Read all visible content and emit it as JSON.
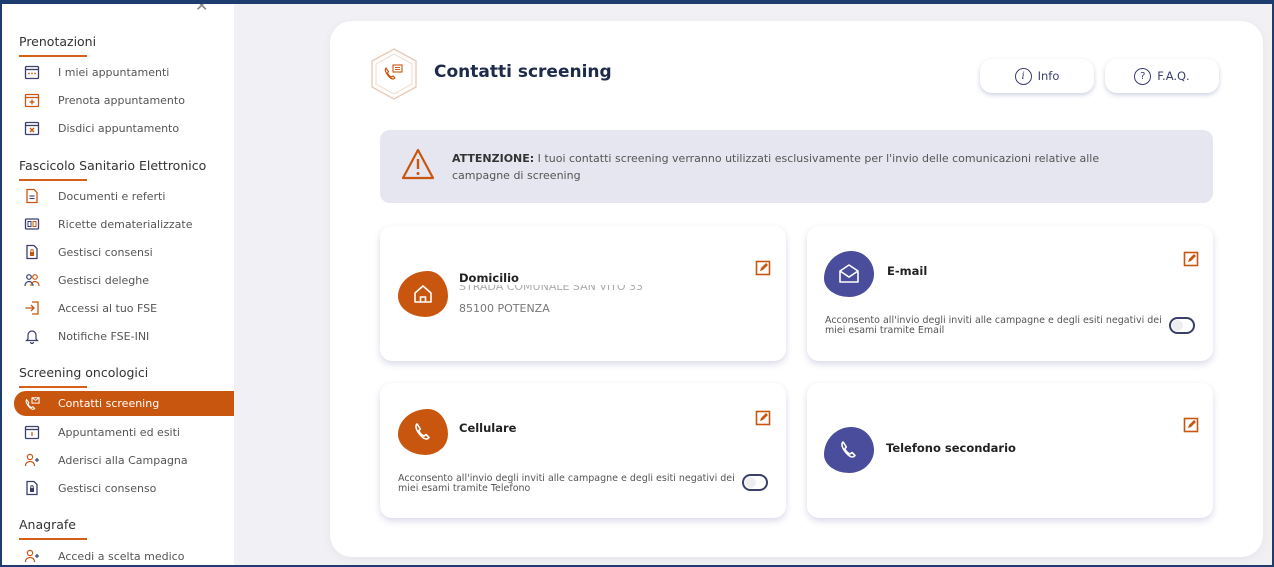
{
  "sidebar": {
    "sections": [
      {
        "title": "Prenotazioni"
      },
      {
        "title": "Fascicolo Sanitario Elettronico"
      },
      {
        "title": "Screening oncologici"
      },
      {
        "title": "Anagrafe"
      }
    ],
    "items": [
      {
        "label": "I miei appuntamenti",
        "icon": "calendar-icon"
      },
      {
        "label": "Prenota appuntamento",
        "icon": "calendar-plus-icon"
      },
      {
        "label": "Disdici appuntamento",
        "icon": "calendar-cancel-icon"
      },
      {
        "label": "Documenti e referti",
        "icon": "document-icon"
      },
      {
        "label": "Ricette dematerializzate",
        "icon": "prescription-icon"
      },
      {
        "label": "Gestisci consensi",
        "icon": "lock-document-icon"
      },
      {
        "label": "Gestisci deleghe",
        "icon": "users-icon"
      },
      {
        "label": "Accessi al tuo FSE",
        "icon": "login-icon"
      },
      {
        "label": "Notifiche FSE-INI",
        "icon": "bell-icon"
      },
      {
        "label": "Contatti screening",
        "icon": "phone-mail-icon",
        "active": true
      },
      {
        "label": "Appuntamenti ed esiti",
        "icon": "calendar-icon"
      },
      {
        "label": "Aderisci alla Campagna",
        "icon": "user-plus-icon"
      },
      {
        "label": "Gestisci consenso",
        "icon": "lock-document-icon"
      },
      {
        "label": "Accedi a scelta medico",
        "icon": "user-plus-icon"
      }
    ]
  },
  "main": {
    "title": "Contatti screening",
    "info_label": "Info",
    "faq_label": "F.A.Q.",
    "alert": {
      "bold": "ATTENZIONE:",
      "text": " I tuoi contatti screening verranno utilizzati esclusivamente per l'invio delle comunicazioni relative alle campagne di screening"
    },
    "cards": {
      "domicilio": {
        "title": "Domicilio",
        "address": "STRADA COMUNALE SAN VITO 33",
        "city": "85100 POTENZA"
      },
      "email": {
        "title": "E-mail",
        "consent": "Acconsento all'invio degli inviti alle campagne e degli esiti negativi dei miei esami tramite Email",
        "consent_on": false
      },
      "cellulare": {
        "title": "Cellulare",
        "consent": "Acconsento all'invio degli inviti alle campagne e degli esiti negativi dei miei esami tramite Telefono",
        "consent_on": false
      },
      "telefono": {
        "title": "Telefono secondario"
      }
    }
  },
  "colors": {
    "accent": "#c8560e",
    "blue": "#4a4d9c",
    "alert_bg": "#e6e6f1"
  }
}
